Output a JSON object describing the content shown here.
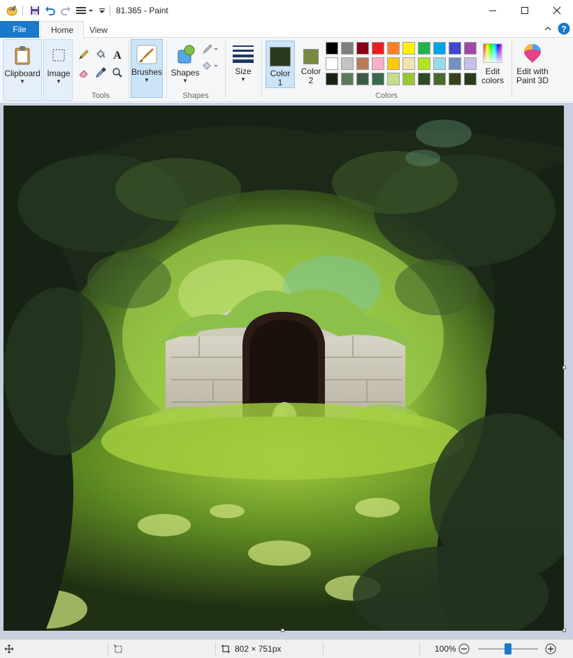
{
  "window": {
    "title": "81.365 - Paint"
  },
  "tabs": {
    "file": "File",
    "home": "Home",
    "view": "View"
  },
  "ribbon": {
    "clipboard": "Clipboard",
    "image": "Image",
    "tools_label": "Tools",
    "brushes": "Brushes",
    "shapes": "Shapes",
    "shapes_group_label": "Shapes",
    "size": "Size",
    "color1_line1": "Color",
    "color1_line2": "1",
    "color2_line1": "Color",
    "color2_line2": "2",
    "colors_label": "Colors",
    "edit_colors_line1": "Edit",
    "edit_colors_line2": "colors",
    "paint3d_line1": "Edit with",
    "paint3d_line2": "Paint 3D"
  },
  "colors": {
    "accent": "#1979ca",
    "color1": "#2b3a1e",
    "color2": "#7a8a3e",
    "palette": [
      "#000000",
      "#7f7f7f",
      "#880015",
      "#ed1c24",
      "#ff7f27",
      "#fff200",
      "#22b14c",
      "#00a2e8",
      "#3f48cc",
      "#a349a4",
      "#ffffff",
      "#c3c3c3",
      "#b97a57",
      "#ffaec9",
      "#ffc90e",
      "#efe4b0",
      "#b5e61d",
      "#99d9ea",
      "#7092be",
      "#c8bfe7",
      "#1a2416",
      "#5a7a5a",
      "#3d5a48",
      "#3a6a50",
      "#c6e08a",
      "#9ac634",
      "#2e4a24",
      "#4a6a2a",
      "#33441e",
      "#2a3a1e"
    ]
  },
  "status": {
    "dimensions": "802 × 751px",
    "zoom": "100%"
  }
}
